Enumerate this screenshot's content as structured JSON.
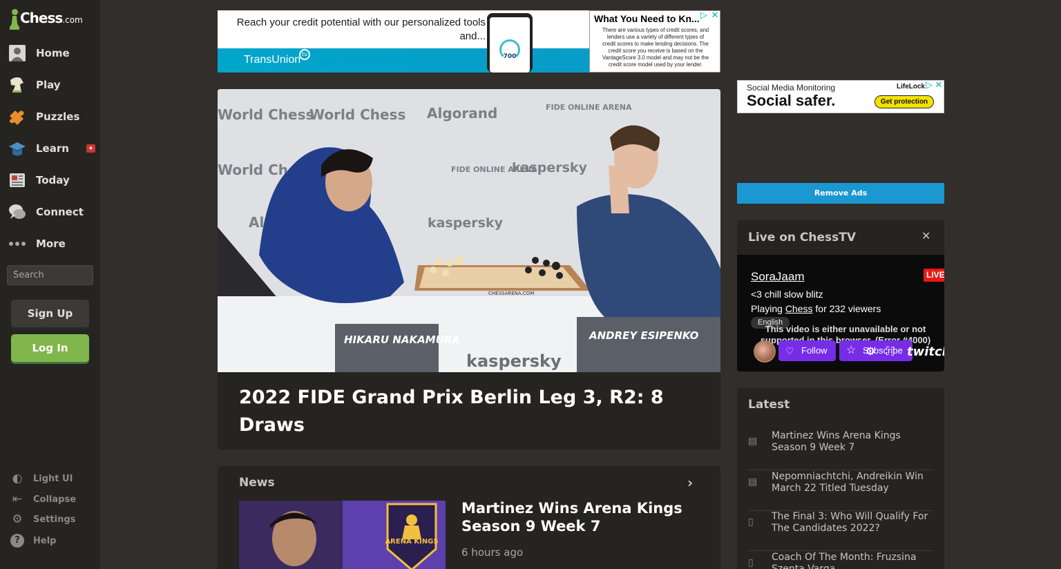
{
  "sidebar": {
    "logo": {
      "main": "Chess",
      "suffix": ".com"
    },
    "items": [
      {
        "label": "Home",
        "icon": "home-icon"
      },
      {
        "label": "Play",
        "icon": "play-icon"
      },
      {
        "label": "Puzzles",
        "icon": "puzzle-icon"
      },
      {
        "label": "Learn",
        "icon": "learn-icon"
      },
      {
        "label": "Today",
        "icon": "newspaper-icon"
      },
      {
        "label": "Connect",
        "icon": "chat-icon"
      },
      {
        "label": "More",
        "icon": "more-icon"
      }
    ],
    "search_placeholder": "Search",
    "signup_label": "Sign Up",
    "login_label": "Log In",
    "footer": [
      {
        "label": "Light UI",
        "icon": "light-ui-icon"
      },
      {
        "label": "Collapse",
        "icon": "collapse-icon"
      },
      {
        "label": "Settings",
        "icon": "settings-icon"
      },
      {
        "label": "Help",
        "icon": "help-icon"
      }
    ]
  },
  "ad_top": {
    "headline": "Reach your credit potential with our personalized tools and...",
    "brand": "TransUnion",
    "phone_score": "700",
    "right_title": "What You Need to Kn...",
    "right_body_lines": [
      "There are various types of credit scores, and",
      "lenders use a variety of different types of",
      "credit scores to make lending decisions. The",
      "credit score you receive is based on the",
      "VantageScore 3.0 model and may not be the",
      "credit score model used by your lender."
    ]
  },
  "ad_side": {
    "small": "Social Media Monitoring",
    "big": "Social safer.",
    "brand": "LifeLock",
    "cta": "Get protection"
  },
  "remove_ads_label": "Remove Ads",
  "hero": {
    "title": "2022 FIDE Grand Prix Berlin Leg 3, R2: 8 Draws",
    "image_text": {
      "backdrop": [
        "World Chess",
        "Algorand",
        "FIDE ONLINE ARENA",
        "kaspersky"
      ],
      "player_left": "HIKARU NAKAMURA",
      "player_right": "ANDREY ESIPENKO",
      "table_sponsor": "kaspersky",
      "board_brand": "CHESSARENA.COM"
    }
  },
  "news": {
    "header": "News",
    "article_title": "Martinez Wins Arena Kings Season 9 Week 7",
    "article_time": "6 hours ago",
    "thumb_text": "ARENA KINGS"
  },
  "chesstv": {
    "title": "Live on ChessTV",
    "channel": "SoraJaam",
    "description": "<3 chill slow blitz",
    "playing_prefix": "Playing",
    "playing_game": "Chess",
    "playing_suffix": "for 232 viewers",
    "language": "English",
    "live_badge": "LIVE",
    "error": "This video is either unavailable or not supported in this browser. (Error #4000)",
    "follow_label": "Follow",
    "subscribe_label": "Subscribe",
    "twitch_label": "twitch"
  },
  "latest": {
    "title": "Latest",
    "items": [
      {
        "text": "Martinez Wins Arena Kings Season 9 Week 7",
        "icon": "news-icon"
      },
      {
        "text": "Nepomniachtchi, Andreikin Win March 22 Titled Tuesday",
        "icon": "news-icon"
      },
      {
        "text": "The Final 3: Who Will Qualify For The Candidates 2022?",
        "icon": "article-icon"
      },
      {
        "text": "Coach Of The Month: Fruzsina Szenta Varga",
        "icon": "article-icon"
      }
    ]
  },
  "colors": {
    "background": "#312e2b",
    "sidebar": "#262421",
    "accent_green": "#81b64c",
    "remove_ads_blue": "#1b97d1",
    "twitch_purple": "#772ce8",
    "live_red": "#e91916"
  }
}
